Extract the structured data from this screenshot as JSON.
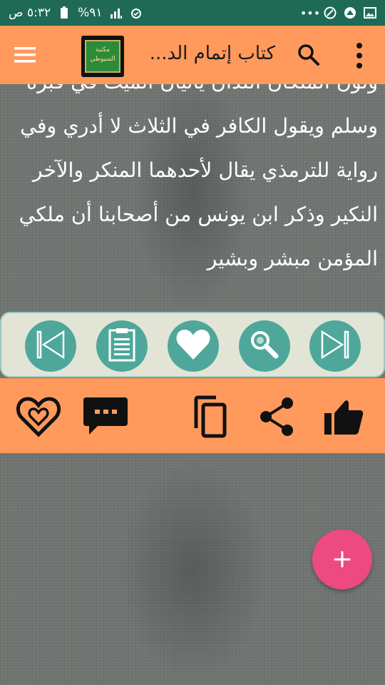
{
  "status_bar": {
    "time": "٥:٣٢ ص",
    "battery": "%٩١",
    "icons": [
      "alarm-icon",
      "signal-icon",
      "battery-icon",
      "image-icon",
      "shield-icon",
      "vpn-icon",
      "more-notifications-icon"
    ]
  },
  "app_bar": {
    "title": "كتاب إتمام الد...",
    "logo_text": [
      "مكتبة",
      "السيوطي"
    ],
    "icons": [
      "more-vert-icon",
      "search-icon",
      "menu-icon"
    ]
  },
  "reader": {
    "lines": [
      "ولون الملكان اللذان يأتيان الميت في قبره",
      "وسلم ويقول الكافر في الثلاث لا أدري وفي",
      "رواية للترمذي يقال لأحدهما المنكر والآخر",
      "النكير وذكر ابن يونس من أصحابنا أن ملكي",
      "المؤمن مبشر وبشير"
    ]
  },
  "nav_toolbar": {
    "buttons": [
      "skip-first-icon",
      "clipboard-icon",
      "heart-icon",
      "search-icon",
      "skip-last-icon"
    ]
  },
  "action_bar": {
    "buttons": [
      "heart-outline-icon",
      "comment-icon",
      "copy-icon",
      "share-icon",
      "thumb-up-icon"
    ]
  },
  "fab": {
    "label": "+"
  },
  "colors": {
    "status_bar": "#1f6a55",
    "app_bar": "#ff9a5c",
    "nav_button": "#4ea79a",
    "fab": "#ec4a80",
    "text": "#ffffff"
  }
}
